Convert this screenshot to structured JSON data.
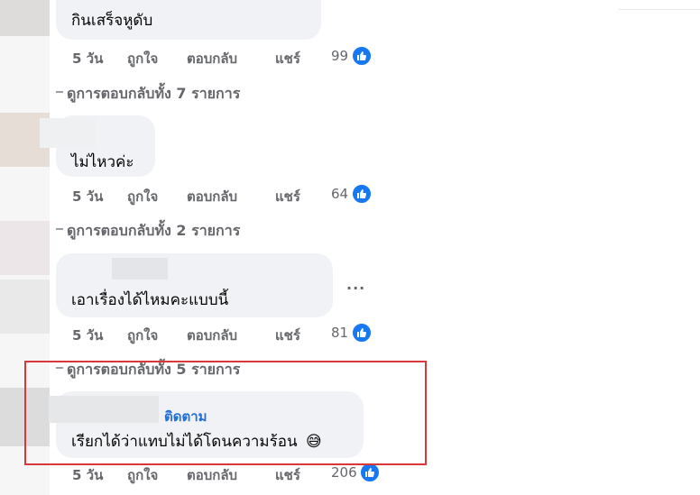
{
  "actions": {
    "time": "5 วัน",
    "like": "ถูกใจ",
    "reply": "ตอบกลับ",
    "share": "แชร์"
  },
  "comments": [
    {
      "text": "กินเสร็จหูดับ",
      "reactions": "99",
      "view_replies": "ดูการตอบกลับทั้ง 7 รายการ"
    },
    {
      "text": "ไม่ไหวค่ะ",
      "reactions": "64",
      "view_replies": "ดูการตอบกลับทั้ง 2 รายการ"
    },
    {
      "text": "เอาเรื่องได้ไหมคะแบบนี้",
      "reactions": "81",
      "view_replies": "ดูการตอบกลับทั้ง 5 รายการ",
      "more": "..."
    },
    {
      "text": "เรียกได้ว่าแทบไม่ได้โดนความร้อน",
      "emoji": "😅",
      "follow": "ติดตาม",
      "reactions": "206"
    }
  ],
  "colors": {
    "bubble": "#f0f2f5",
    "meta_text": "#65676b",
    "like_blue": "#1877f2",
    "follow_blue": "#216fdb",
    "highlight_red": "#d9383a"
  },
  "icons": [
    "thumbs-up-icon",
    "more-options-icon"
  ]
}
